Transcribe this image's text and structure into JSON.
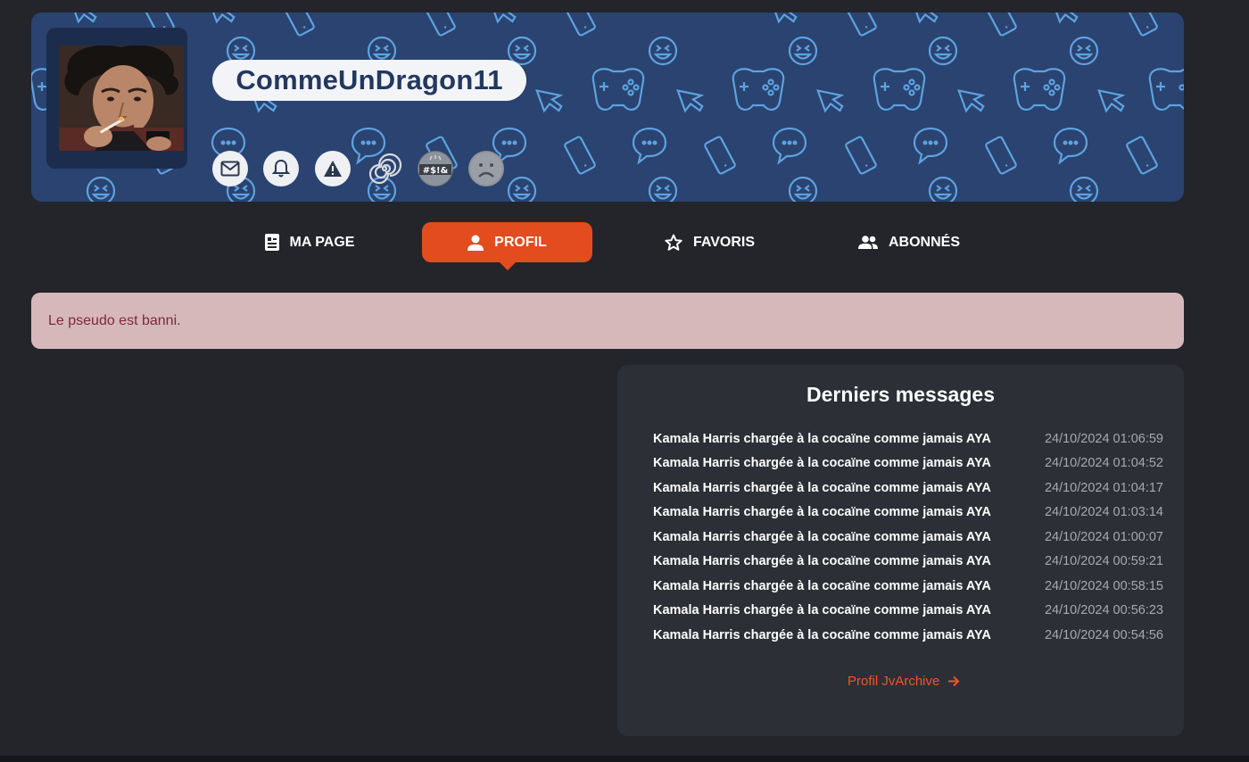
{
  "profile": {
    "username": "CommeUnDragon11",
    "badges": [
      {
        "name": "mail-icon"
      },
      {
        "name": "bell-icon"
      },
      {
        "name": "warning-icon"
      },
      {
        "name": "spiral-badge-icon"
      },
      {
        "name": "swear-badge-icon",
        "text": "#$!&"
      },
      {
        "name": "sad-face-badge-icon"
      }
    ],
    "colors": {
      "banner": "#2a4370",
      "pattern": "#5ea2e0",
      "accent": "#e24c1e"
    }
  },
  "nav": {
    "tabs": [
      {
        "label": "MA PAGE",
        "icon": "page-icon"
      },
      {
        "label": "PROFIL",
        "icon": "person-icon",
        "active": true
      },
      {
        "label": "FAVORIS",
        "icon": "star-icon"
      },
      {
        "label": "ABONNÉS",
        "icon": "group-icon"
      }
    ]
  },
  "alert": {
    "text": "Le pseudo est banni."
  },
  "messages": {
    "title": "Derniers messages",
    "items": [
      {
        "title": "Kamala Harris chargée à la cocaïne comme jamais AYA",
        "date": "24/10/2024 01:06:59"
      },
      {
        "title": "Kamala Harris chargée à la cocaïne comme jamais AYA",
        "date": "24/10/2024 01:04:52"
      },
      {
        "title": "Kamala Harris chargée à la cocaïne comme jamais AYA",
        "date": "24/10/2024 01:04:17"
      },
      {
        "title": "Kamala Harris chargée à la cocaïne comme jamais AYA",
        "date": "24/10/2024 01:03:14"
      },
      {
        "title": "Kamala Harris chargée à la cocaïne comme jamais AYA",
        "date": "24/10/2024 01:00:07"
      },
      {
        "title": "Kamala Harris chargée à la cocaïne comme jamais AYA",
        "date": "24/10/2024 00:59:21"
      },
      {
        "title": "Kamala Harris chargée à la cocaïne comme jamais AYA",
        "date": "24/10/2024 00:58:15"
      },
      {
        "title": "Kamala Harris chargée à la cocaïne comme jamais AYA",
        "date": "24/10/2024 00:56:23"
      },
      {
        "title": "Kamala Harris chargée à la cocaïne comme jamais AYA",
        "date": "24/10/2024 00:54:56"
      }
    ],
    "link": {
      "label": "Profil JvArchive",
      "icon": "arrow-right-icon"
    }
  }
}
